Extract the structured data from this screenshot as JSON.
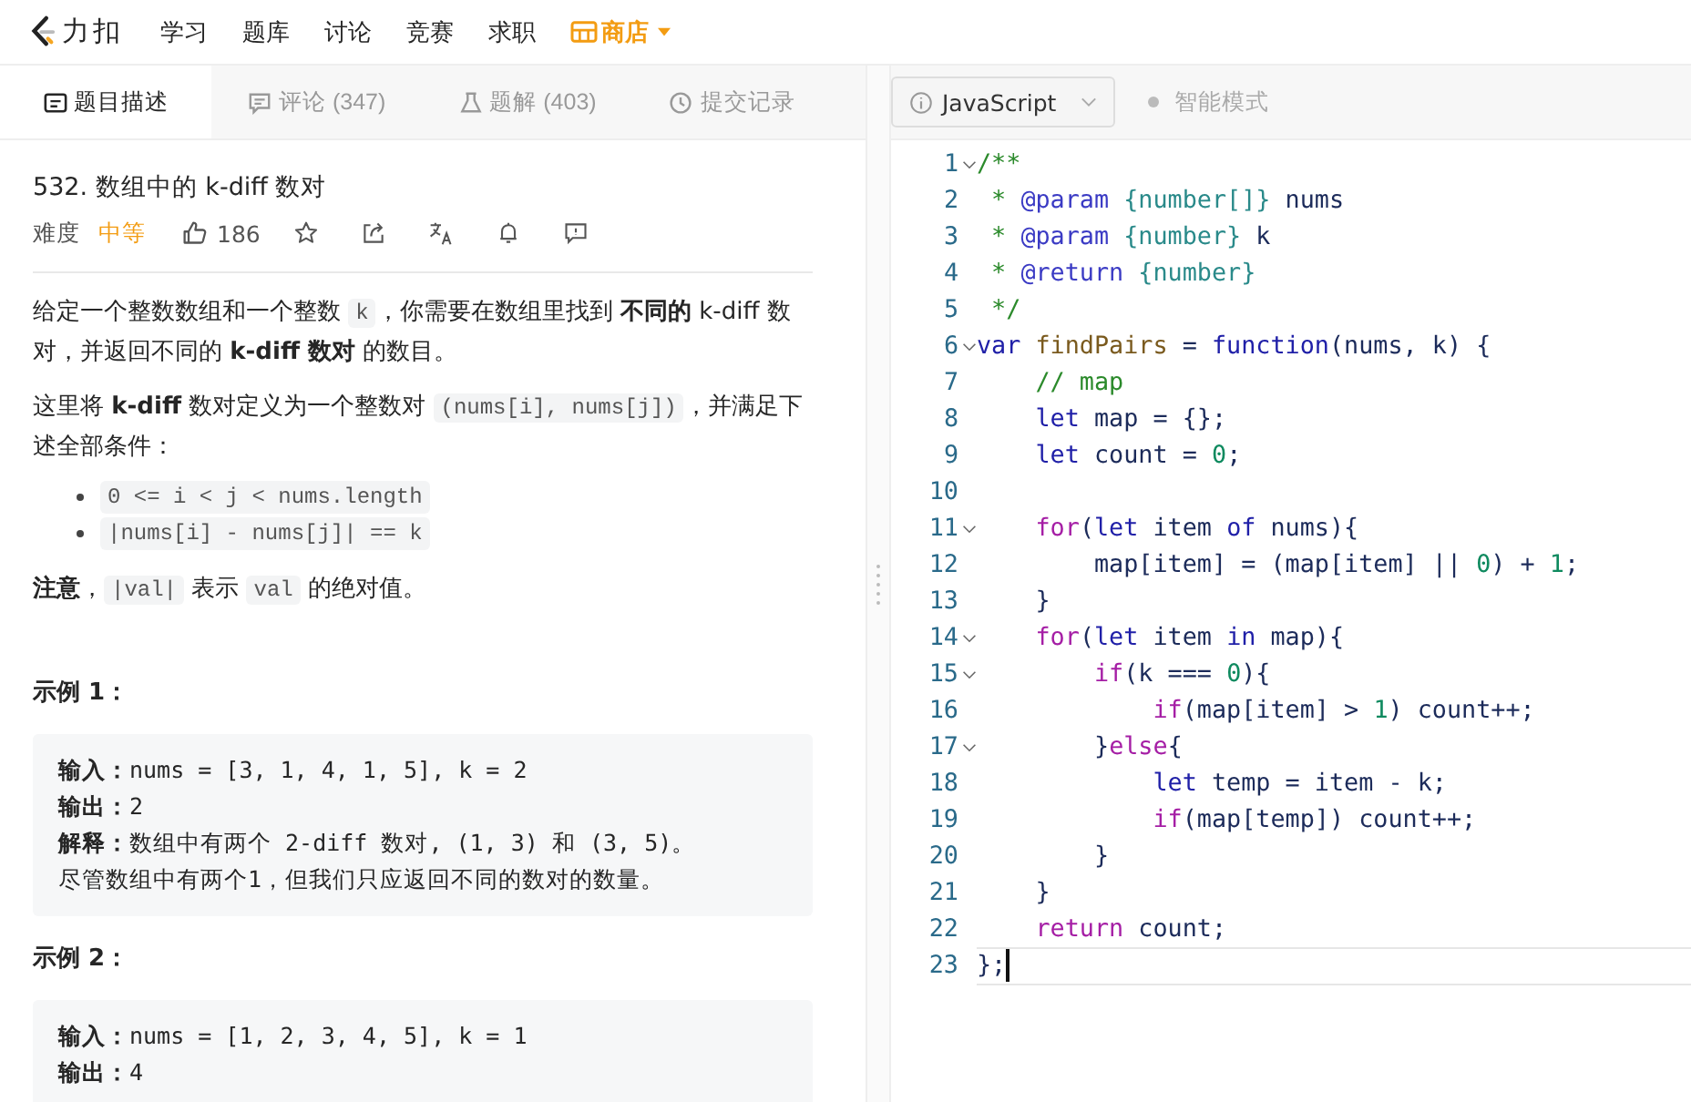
{
  "nav": {
    "logo": "力扣",
    "items": [
      "学习",
      "题库",
      "讨论",
      "竞赛",
      "求职"
    ],
    "store": "商店"
  },
  "tabs": [
    {
      "label": "题目描述",
      "selected": true
    },
    {
      "label": "评论 (347)",
      "selected": false
    },
    {
      "label": "题解 (403)",
      "selected": false
    },
    {
      "label": "提交记录",
      "selected": false
    }
  ],
  "problem": {
    "title": "532. 数组中的 k-diff 数对",
    "difficulty_label": "难度",
    "difficulty": "中等",
    "likes": "186",
    "paragraphs": [
      [
        {
          "kind": "text",
          "text": "给定一个整数数组和一个整数 "
        },
        {
          "kind": "code",
          "text": "k"
        },
        {
          "kind": "text",
          "text": "，你需要在数组里找到 "
        },
        {
          "kind": "bold",
          "text": "不同的"
        },
        {
          "kind": "text",
          "text": " k-diff 数对，并返回不同的 "
        },
        {
          "kind": "bold",
          "text": "k-diff 数对"
        },
        {
          "kind": "text",
          "text": " 的数目。"
        }
      ],
      [
        {
          "kind": "text",
          "text": "这里将 "
        },
        {
          "kind": "bold",
          "text": "k-diff"
        },
        {
          "kind": "text",
          "text": " 数对定义为一个整数对 "
        },
        {
          "kind": "code",
          "text": "(nums[i], nums[j])"
        },
        {
          "kind": "text",
          "text": "，并满足下述全部条件："
        }
      ]
    ],
    "bullets": [
      "0 <= i < j < nums.length",
      "|nums[i] - nums[j]| == k"
    ],
    "note": [
      {
        "kind": "bold",
        "text": "注意"
      },
      {
        "kind": "text",
        "text": "，"
      },
      {
        "kind": "code",
        "text": "|val|"
      },
      {
        "kind": "text",
        "text": " 表示 "
      },
      {
        "kind": "code",
        "text": "val"
      },
      {
        "kind": "text",
        "text": " 的绝对值。"
      }
    ],
    "examples": [
      {
        "heading": "示例 1：",
        "lines": [
          {
            "label": "输入：",
            "text": "nums = [3, 1, 4, 1, 5], k = 2"
          },
          {
            "label": "输出：",
            "text": "2"
          },
          {
            "label": "解释：",
            "text": "数组中有两个 2-diff 数对, (1, 3) 和 (3, 5)。"
          },
          {
            "text": "尽管数组中有两个1，但我们只应返回不同的数对的数量。"
          }
        ]
      },
      {
        "heading": "示例 2：",
        "lines": [
          {
            "label": "输入：",
            "text": "nums = [1, 2, 3, 4, 5], k = 1"
          },
          {
            "label": "输出：",
            "text": "4"
          }
        ]
      }
    ]
  },
  "editor": {
    "language": "JavaScript",
    "smart_mode": {
      "label": "智能模式",
      "on": false
    },
    "lines": [
      {
        "number": "1",
        "foldable": true,
        "current": false,
        "tokens": [
          {
            "kind": "comment",
            "text": "/**"
          }
        ]
      },
      {
        "number": "2",
        "foldable": false,
        "current": false,
        "tokens": [
          {
            "kind": "comment",
            "text": " * "
          },
          {
            "kind": "tag",
            "text": "@param"
          },
          {
            "kind": "type",
            "text": " {number[]}"
          },
          {
            "kind": "plain",
            "text": " nums"
          }
        ]
      },
      {
        "number": "3",
        "foldable": false,
        "current": false,
        "tokens": [
          {
            "kind": "comment",
            "text": " * "
          },
          {
            "kind": "tag",
            "text": "@param"
          },
          {
            "kind": "type",
            "text": " {number}"
          },
          {
            "kind": "plain",
            "text": " k"
          }
        ]
      },
      {
        "number": "4",
        "foldable": false,
        "current": false,
        "tokens": [
          {
            "kind": "comment",
            "text": " * "
          },
          {
            "kind": "tag",
            "text": "@return"
          },
          {
            "kind": "type",
            "text": " {number}"
          }
        ]
      },
      {
        "number": "5",
        "foldable": false,
        "current": false,
        "tokens": [
          {
            "kind": "comment",
            "text": " */"
          }
        ]
      },
      {
        "number": "6",
        "foldable": true,
        "current": false,
        "tokens": [
          {
            "kind": "keyword",
            "text": "var"
          },
          {
            "kind": "def",
            "text": " findPairs"
          },
          {
            "kind": "plain",
            "text": " = "
          },
          {
            "kind": "keyword",
            "text": "function"
          },
          {
            "kind": "plain",
            "text": "(nums, k) {"
          }
        ]
      },
      {
        "number": "7",
        "foldable": false,
        "current": false,
        "tokens": [
          {
            "kind": "comment",
            "text": "    // map"
          }
        ]
      },
      {
        "number": "8",
        "foldable": false,
        "current": false,
        "tokens": [
          {
            "kind": "keyword",
            "text": "    let"
          },
          {
            "kind": "plain",
            "text": " map = {};"
          }
        ]
      },
      {
        "number": "9",
        "foldable": false,
        "current": false,
        "tokens": [
          {
            "kind": "keyword",
            "text": "    let"
          },
          {
            "kind": "plain",
            "text": " count = "
          },
          {
            "kind": "number",
            "text": "0"
          },
          {
            "kind": "plain",
            "text": ";"
          }
        ]
      },
      {
        "number": "10",
        "foldable": false,
        "current": false
      },
      {
        "number": "11",
        "foldable": true,
        "current": false,
        "tokens": [
          {
            "kind": "control",
            "text": "    for"
          },
          {
            "kind": "plain",
            "text": "("
          },
          {
            "kind": "keyword",
            "text": "let"
          },
          {
            "kind": "plain",
            "text": " item "
          },
          {
            "kind": "keyword",
            "text": "of"
          },
          {
            "kind": "plain",
            "text": " nums){"
          }
        ]
      },
      {
        "number": "12",
        "foldable": false,
        "current": false,
        "tokens": [
          {
            "kind": "plain",
            "text": "        map[item] = (map[item] || "
          },
          {
            "kind": "number",
            "text": "0"
          },
          {
            "kind": "plain",
            "text": ") + "
          },
          {
            "kind": "number",
            "text": "1"
          },
          {
            "kind": "plain",
            "text": ";"
          }
        ]
      },
      {
        "number": "13",
        "foldable": false,
        "current": false,
        "tokens": [
          {
            "kind": "plain",
            "text": "    }"
          }
        ]
      },
      {
        "number": "14",
        "foldable": true,
        "current": false,
        "tokens": [
          {
            "kind": "control",
            "text": "    for"
          },
          {
            "kind": "plain",
            "text": "("
          },
          {
            "kind": "keyword",
            "text": "let"
          },
          {
            "kind": "plain",
            "text": " item "
          },
          {
            "kind": "keyword",
            "text": "in"
          },
          {
            "kind": "plain",
            "text": " map){"
          }
        ]
      },
      {
        "number": "15",
        "foldable": true,
        "current": false,
        "tokens": [
          {
            "kind": "control",
            "text": "        if"
          },
          {
            "kind": "plain",
            "text": "(k === "
          },
          {
            "kind": "number",
            "text": "0"
          },
          {
            "kind": "plain",
            "text": "){"
          }
        ]
      },
      {
        "number": "16",
        "foldable": false,
        "current": false,
        "tokens": [
          {
            "kind": "control",
            "text": "            if"
          },
          {
            "kind": "plain",
            "text": "(map[item] > "
          },
          {
            "kind": "number",
            "text": "1"
          },
          {
            "kind": "plain",
            "text": ") count++;"
          }
        ]
      },
      {
        "number": "17",
        "foldable": true,
        "current": false,
        "tokens": [
          {
            "kind": "plain",
            "text": "        }"
          },
          {
            "kind": "control",
            "text": "else"
          },
          {
            "kind": "plain",
            "text": "{"
          }
        ]
      },
      {
        "number": "18",
        "foldable": false,
        "current": false,
        "tokens": [
          {
            "kind": "keyword",
            "text": "            let"
          },
          {
            "kind": "plain",
            "text": " temp = item - k;"
          }
        ]
      },
      {
        "number": "19",
        "foldable": false,
        "current": false,
        "tokens": [
          {
            "kind": "control",
            "text": "            if"
          },
          {
            "kind": "plain",
            "text": "(map[temp]) count++;"
          }
        ]
      },
      {
        "number": "20",
        "foldable": false,
        "current": false,
        "tokens": [
          {
            "kind": "plain",
            "text": "        }"
          }
        ]
      },
      {
        "number": "21",
        "foldable": false,
        "current": false,
        "tokens": [
          {
            "kind": "plain",
            "text": "    }"
          }
        ]
      },
      {
        "number": "22",
        "foldable": false,
        "current": false,
        "tokens": [
          {
            "kind": "control",
            "text": "    return"
          },
          {
            "kind": "plain",
            "text": " count;"
          }
        ]
      },
      {
        "number": "23",
        "foldable": false,
        "current": true,
        "tokens": [
          {
            "kind": "plain",
            "text": "};"
          }
        ]
      }
    ]
  }
}
